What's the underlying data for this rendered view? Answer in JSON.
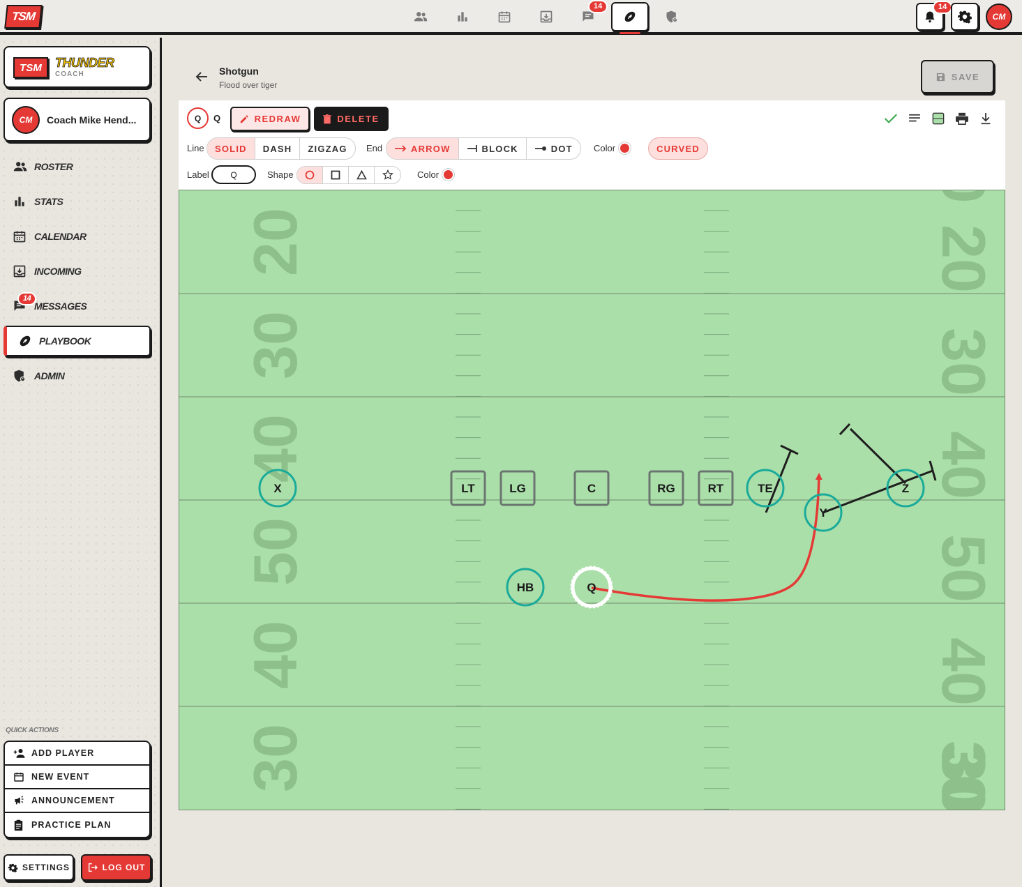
{
  "app": {
    "logo_text": "TSM",
    "brand_name": "THUNDER",
    "brand_role": "COACH",
    "user_initials": "CM",
    "user_name": "Coach Mike Hend...",
    "accent_color": "#e53935"
  },
  "topnav": {
    "items": [
      {
        "icon": "people-icon"
      },
      {
        "icon": "bar-chart-icon"
      },
      {
        "icon": "calendar-icon"
      },
      {
        "icon": "inbox-icon"
      },
      {
        "icon": "chat-icon",
        "badge": "14"
      },
      {
        "icon": "football-icon",
        "active": true
      },
      {
        "icon": "admin-shield-icon"
      }
    ],
    "notification_badge": "14"
  },
  "sidebar": {
    "items": [
      {
        "label": "ROSTER",
        "icon": "people-icon"
      },
      {
        "label": "STATS",
        "icon": "bar-chart-icon"
      },
      {
        "label": "CALENDAR",
        "icon": "calendar-icon"
      },
      {
        "label": "INCOMING",
        "icon": "inbox-icon"
      },
      {
        "label": "MESSAGES",
        "icon": "chat-icon",
        "badge": "14"
      },
      {
        "label": "PLAYBOOK",
        "icon": "football-icon",
        "active": true
      },
      {
        "label": "ADMIN",
        "icon": "admin-shield-icon"
      }
    ],
    "quick_actions_title": "QUICK ACTIONS",
    "quick_actions": [
      {
        "label": "ADD PLAYER",
        "icon": "add-person-icon"
      },
      {
        "label": "NEW EVENT",
        "icon": "calendar-icon"
      },
      {
        "label": "ANNOUNCEMENT",
        "icon": "megaphone-icon"
      },
      {
        "label": "PRACTICE PLAN",
        "icon": "clipboard-icon"
      }
    ],
    "settings_label": "SETTINGS",
    "logout_label": "LOG OUT"
  },
  "play": {
    "title": "Shotgun",
    "subtitle": "Flood over tiger",
    "save_label": "SAVE"
  },
  "toolbar": {
    "selected_player": "Q",
    "selected_label": "Q",
    "redraw_label": "REDRAW",
    "delete_label": "DELETE",
    "line_label": "Line",
    "line_options": [
      "SOLID",
      "DASH",
      "ZIGZAG"
    ],
    "line_selected": "SOLID",
    "end_label": "End",
    "end_options": [
      "ARROW",
      "BLOCK",
      "DOT"
    ],
    "end_selected": "ARROW",
    "color_label": "Color",
    "curved_label": "CURVED",
    "label_label": "Label",
    "label_value": "Q",
    "shape_label": "Shape",
    "shape_options": [
      "circle",
      "square",
      "triangle",
      "star"
    ],
    "shape_selected": "circle",
    "color2_label": "Color",
    "route_color": "#e53935"
  },
  "field": {
    "left_numbers": [
      "20",
      "30",
      "40",
      "50",
      "40",
      "30"
    ],
    "right_numbers": [
      "20",
      "30",
      "40",
      "50",
      "40",
      "30"
    ],
    "players": [
      {
        "label": "X",
        "shape": "circle"
      },
      {
        "label": "LT",
        "shape": "square"
      },
      {
        "label": "LG",
        "shape": "square"
      },
      {
        "label": "C",
        "shape": "square"
      },
      {
        "label": "RG",
        "shape": "square"
      },
      {
        "label": "RT",
        "shape": "square"
      },
      {
        "label": "TE",
        "shape": "circle"
      },
      {
        "label": "Y",
        "shape": "circle"
      },
      {
        "label": "Z",
        "shape": "circle"
      },
      {
        "label": "HB",
        "shape": "circle"
      },
      {
        "label": "Q",
        "shape": "circle",
        "selected": true
      }
    ],
    "colors": {
      "grass": "#abdfaa",
      "player_ring": "#1aaa9a",
      "line_ink": "#1e1e1e",
      "route_selected": "#e53935"
    }
  }
}
